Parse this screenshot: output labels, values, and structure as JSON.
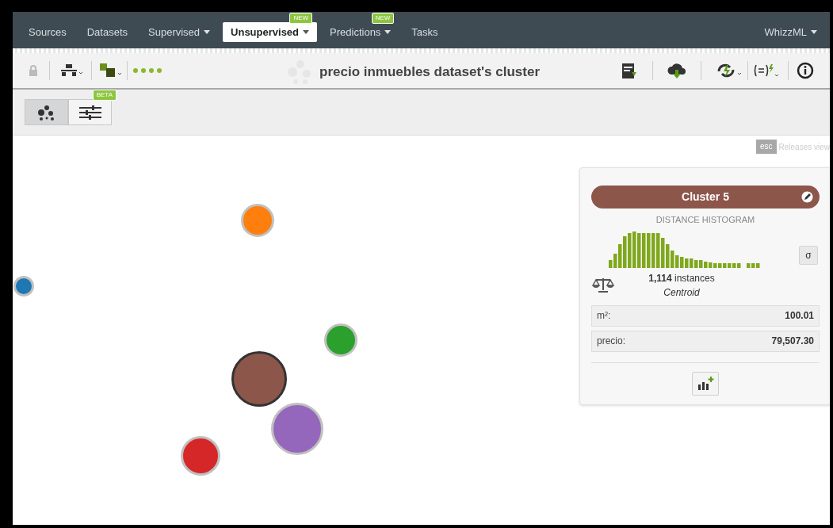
{
  "nav": {
    "items": [
      {
        "label": "Sources",
        "selected": false,
        "dropdown": false
      },
      {
        "label": "Datasets",
        "selected": false,
        "dropdown": false
      },
      {
        "label": "Supervised",
        "selected": false,
        "dropdown": true
      },
      {
        "label": "Unsupervised",
        "selected": true,
        "dropdown": true,
        "badge": "NEW"
      },
      {
        "label": "Predictions",
        "selected": false,
        "dropdown": true,
        "badge": "NEW"
      },
      {
        "label": "Tasks",
        "selected": false,
        "dropdown": false
      }
    ],
    "right": {
      "label": "WhizzML",
      "dropdown": true
    }
  },
  "toolbar": {
    "title": "precio inmuebles dataset's cluster"
  },
  "view_switch": [
    {
      "kind": "clusters",
      "selected": true
    },
    {
      "kind": "sliders",
      "selected": false,
      "badge": "BETA"
    }
  ],
  "release_hint": {
    "key": "esc",
    "text": "Releases view"
  },
  "clusters": [
    {
      "color": "#ff7f0e",
      "selected": false
    },
    {
      "color": "#1f77b4",
      "selected": false
    },
    {
      "color": "#2ca02c",
      "selected": false
    },
    {
      "color": "#8c564b",
      "selected": true
    },
    {
      "color": "#9467bd",
      "selected": false
    },
    {
      "color": "#d62728",
      "selected": false
    }
  ],
  "panel": {
    "title": "Cluster 5",
    "color": "#8c564b",
    "histogram_title": "DISTANCE HISTOGRAM",
    "sigma": "σ",
    "instances_count": "1,114",
    "instances_label": "instances",
    "centroid": "Centroid",
    "fields": [
      {
        "name": "m²:",
        "value": "100.01"
      },
      {
        "name": "precio:",
        "value": "79,507.30"
      }
    ]
  }
}
